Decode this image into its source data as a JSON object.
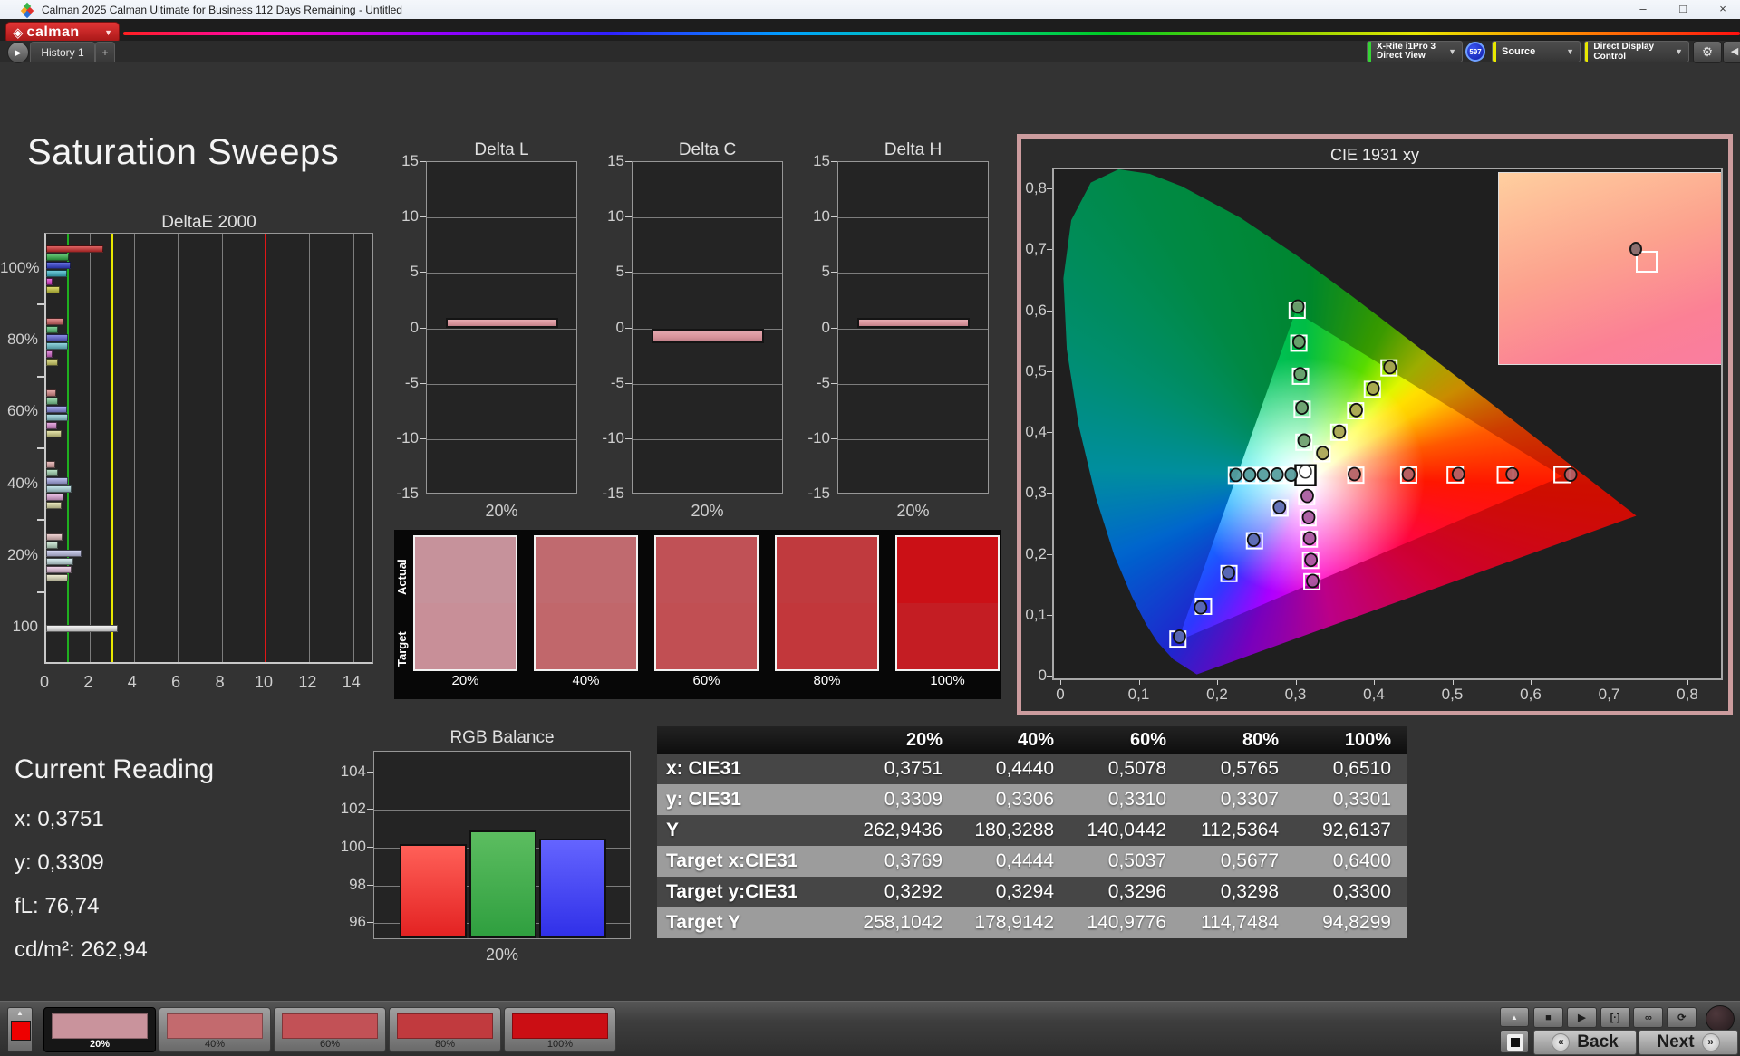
{
  "window": {
    "title": "Calman 2025 Calman Ultimate for Business 112 Days Remaining  - Untitled",
    "minimize_glyph": "–",
    "maximize_glyph": "□",
    "close_glyph": "×"
  },
  "brand": {
    "logo_glyph": "◈",
    "logo_text": "calman",
    "caret_glyph": "▼"
  },
  "toolbar": {
    "history_prev_glyph": "▶",
    "history_tab": "History 1",
    "add_tab": "+",
    "meter_dropdown": {
      "line1": "X-Rite i1Pro 3",
      "line2": "Direct View",
      "stripe": "#35d435"
    },
    "meter_badge": "597",
    "source_dropdown": {
      "label": "Source",
      "stripe": "#e8e800"
    },
    "display_dropdown": {
      "label": "Direct Display Control",
      "stripe": "#e8e800"
    },
    "gear_glyph": "⚙",
    "collapse_glyph": "◀",
    "caret_glyph": "▼"
  },
  "page": {
    "heading": "Saturation Sweeps"
  },
  "swatch_panel": {
    "row_labels": [
      "Actual",
      "Target"
    ],
    "swatches": [
      {
        "label": "20%",
        "actual": "#c6929b",
        "target": "#c88f98"
      },
      {
        "label": "40%",
        "actual": "#c06a6f",
        "target": "#c1676b"
      },
      {
        "label": "60%",
        "actual": "#c05156",
        "target": "#c14f53"
      },
      {
        "label": "80%",
        "actual": "#c03a3e",
        "target": "#c2373b"
      },
      {
        "label": "100%",
        "actual": "#cb1016",
        "target": "#c41d23"
      }
    ]
  },
  "current_reading": {
    "heading": "Current Reading",
    "lines": [
      "x: 0,3751",
      "y: 0,3309",
      "fL: 76,74",
      "cd/m²: 262,94"
    ]
  },
  "bottom_bar": {
    "patch_button": {
      "up_glyph": "▲",
      "patch_color": "#ee0000"
    },
    "swatches": [
      {
        "label": "20%",
        "color": "#c9939c",
        "selected": true
      },
      {
        "label": "40%",
        "color": "#c36a6e",
        "selected": false
      },
      {
        "label": "60%",
        "color": "#c25156",
        "selected": false
      },
      {
        "label": "80%",
        "color": "#c13a3e",
        "selected": false
      },
      {
        "label": "100%",
        "color": "#cb0e14",
        "selected": false
      }
    ],
    "up_glyph": "▲",
    "transport": [
      {
        "name": "stop",
        "glyph": "■"
      },
      {
        "name": "play",
        "glyph": "▶"
      },
      {
        "name": "single",
        "glyph": "[·]"
      },
      {
        "name": "loop",
        "glyph": "∞"
      },
      {
        "name": "refresh",
        "glyph": "⟳"
      }
    ],
    "back_label": "Back",
    "next_label": "Next",
    "prev_glyph": "«",
    "next_glyph": "»"
  },
  "chart_data": {
    "deltae2000": {
      "type": "bar",
      "orientation": "horizontal",
      "title": "DeltaE 2000",
      "xticks": [
        0,
        2,
        4,
        6,
        8,
        10,
        12,
        14
      ],
      "xlim": [
        0,
        15
      ],
      "ref_lines": [
        {
          "value": 1,
          "color": "#1faf1f"
        },
        {
          "value": 3,
          "color": "#e8e800"
        },
        {
          "value": 10,
          "color": "#e01616"
        }
      ],
      "groups": [
        {
          "label": "100%",
          "values": [
            2.6,
            1.05,
            1.1,
            0.95,
            0.3,
            0.6
          ],
          "colors": [
            "#d32f2f",
            "#33b54a",
            "#3340d6",
            "#3fb9cc",
            "#e040d0",
            "#cfcf3f"
          ]
        },
        {
          "label": "80%",
          "values": [
            0.8,
            0.55,
            1.0,
            1.0,
            0.3,
            0.55
          ],
          "colors": [
            "#d96a6a",
            "#57c177",
            "#6468de",
            "#6cc5d2",
            "#d668cd",
            "#d6d468"
          ]
        },
        {
          "label": "60%",
          "values": [
            0.45,
            0.55,
            0.95,
            1.0,
            0.5,
            0.7
          ],
          "colors": [
            "#de8c8c",
            "#7fcc96",
            "#8b8fe5",
            "#93d0da",
            "#de8fd6",
            "#dcda8f"
          ]
        },
        {
          "label": "40%",
          "values": [
            0.4,
            0.55,
            1.0,
            1.15,
            0.8,
            0.7
          ],
          "colors": [
            "#e3a9a9",
            "#a3d6b2",
            "#a9ace9",
            "#b1dce2",
            "#e3aadb",
            "#e2e0a9"
          ]
        },
        {
          "label": "20%",
          "values": [
            0.75,
            0.55,
            1.6,
            1.25,
            1.15,
            1.0
          ],
          "colors": [
            "#e9c3c3",
            "#c2e2cb",
            "#c6c8ef",
            "#cbe6ea",
            "#e9c6e2",
            "#e8e6c4"
          ]
        },
        {
          "label": "100",
          "values": [
            3.25
          ],
          "colors": [
            "#f2f2f2"
          ]
        }
      ]
    },
    "delta_small": {
      "type": "bar",
      "yticks": [
        15,
        10,
        5,
        0,
        -5,
        -10,
        -15
      ],
      "ylim": [
        -15,
        15
      ],
      "bar_color": "#d8939b",
      "xlabel": "20%",
      "charts": [
        {
          "title": "Delta L",
          "value": 0.5
        },
        {
          "title": "Delta C",
          "value": -0.9
        },
        {
          "title": "Delta H",
          "value": 0.5
        }
      ]
    },
    "rgb_balance": {
      "type": "bar",
      "title": "RGB Balance",
      "categories": [
        "Red",
        "Green",
        "Blue"
      ],
      "values": [
        100.1,
        100.8,
        100.4
      ],
      "colors_top": [
        "#ff6058",
        "#5cbd60",
        "#6464ff"
      ],
      "colors_bottom": [
        "#e32222",
        "#2f9f3f",
        "#3030e8"
      ],
      "yticks": [
        104,
        102,
        100,
        98,
        96
      ],
      "ylim": [
        95.1,
        105.1
      ],
      "xlabel": "20%"
    },
    "cie": {
      "type": "scatter",
      "title": "CIE 1931 xy",
      "xlim": [
        0,
        0.85
      ],
      "ylim": [
        0,
        0.84
      ],
      "xtick_labels": [
        "0",
        "0,1",
        "0,2",
        "0,3",
        "0,4",
        "0,5",
        "0,6",
        "0,7",
        "0,8"
      ],
      "ytick_labels": [
        "0",
        "0,1",
        "0,2",
        "0,3",
        "0,4",
        "0,5",
        "0,6",
        "0,7",
        "0,8"
      ],
      "tick_step": 0.1,
      "white_point": [
        0.3127,
        0.329
      ],
      "sweeps": [
        {
          "name": "red",
          "tint": "#b26267",
          "targets": [
            [
              0.3769,
              0.3292
            ],
            [
              0.4444,
              0.3294
            ],
            [
              0.5037,
              0.3296
            ],
            [
              0.5677,
              0.3298
            ],
            [
              0.64,
              0.33
            ]
          ],
          "measured": [
            [
              0.3751,
              0.3309
            ],
            [
              0.444,
              0.3306
            ],
            [
              0.5078,
              0.331
            ],
            [
              0.5765,
              0.3307
            ],
            [
              0.651,
              0.3301
            ]
          ]
        },
        {
          "name": "green",
          "tint": "#6f9e6f",
          "targets": [
            [
              0.3106,
              0.3832
            ],
            [
              0.3085,
              0.4374
            ],
            [
              0.3064,
              0.4916
            ],
            [
              0.3042,
              0.5458
            ],
            [
              0.3021,
              0.6
            ]
          ],
          "measured": [
            [
              0.311,
              0.386
            ],
            [
              0.3082,
              0.44
            ],
            [
              0.306,
              0.495
            ],
            [
              0.3045,
              0.548
            ],
            [
              0.303,
              0.606
            ]
          ]
        },
        {
          "name": "blue",
          "tint": "#5c6bb0",
          "targets": [
            [
              0.2802,
              0.2752
            ],
            [
              0.2477,
              0.2214
            ],
            [
              0.2151,
              0.1676
            ],
            [
              0.1826,
              0.1138
            ],
            [
              0.15,
              0.06
            ]
          ],
          "measured": [
            [
              0.2795,
              0.2765
            ],
            [
              0.2465,
              0.223
            ],
            [
              0.2145,
              0.169
            ],
            [
              0.179,
              0.112
            ],
            [
              0.152,
              0.064
            ]
          ]
        },
        {
          "name": "cyan",
          "tint": "#569b9b",
          "targets": [
            [
              0.2951,
              0.329
            ],
            [
              0.2775,
              0.3289
            ],
            [
              0.2598,
              0.3288
            ],
            [
              0.2422,
              0.3288
            ],
            [
              0.2246,
              0.3287
            ]
          ],
          "measured": [
            [
              0.2945,
              0.33
            ],
            [
              0.2765,
              0.3302
            ],
            [
              0.259,
              0.33
            ],
            [
              0.2415,
              0.3298
            ],
            [
              0.224,
              0.3295
            ]
          ]
        },
        {
          "name": "magenta",
          "tint": "#a75a9d",
          "targets": [
            [
              0.3143,
              0.294
            ],
            [
              0.316,
              0.2591
            ],
            [
              0.3176,
              0.2241
            ],
            [
              0.3193,
              0.1892
            ],
            [
              0.3209,
              0.1542
            ]
          ],
          "measured": [
            [
              0.315,
              0.295
            ],
            [
              0.3168,
              0.26
            ],
            [
              0.318,
              0.2255
            ],
            [
              0.3198,
              0.19
            ],
            [
              0.322,
              0.1555
            ]
          ]
        },
        {
          "name": "yellow",
          "tint": "#a8a455",
          "targets": [
            [
              0.334,
              0.3643
            ],
            [
              0.3553,
              0.3996
            ],
            [
              0.3767,
              0.4348
            ],
            [
              0.398,
              0.4701
            ],
            [
              0.4193,
              0.5053
            ]
          ],
          "measured": [
            [
              0.3348,
              0.3655
            ],
            [
              0.356,
              0.4005
            ],
            [
              0.3775,
              0.436
            ],
            [
              0.399,
              0.4715
            ],
            [
              0.4205,
              0.5065
            ]
          ]
        }
      ],
      "inset": {
        "point_frac": [
          0.615,
          0.4
        ],
        "target_frac": [
          0.655,
          0.455
        ]
      }
    },
    "table": {
      "headers": [
        "",
        "20%",
        "40%",
        "60%",
        "80%",
        "100%"
      ],
      "rows": [
        {
          "label": "x: CIE31",
          "values": [
            "0,3751",
            "0,4440",
            "0,5078",
            "0,5765",
            "0,6510"
          ]
        },
        {
          "label": "y: CIE31",
          "values": [
            "0,3309",
            "0,3306",
            "0,3310",
            "0,3307",
            "0,3301"
          ]
        },
        {
          "label": "Y",
          "values": [
            "262,9436",
            "180,3288",
            "140,0442",
            "112,5364",
            "92,6137"
          ]
        },
        {
          "label": "Target x:CIE31",
          "values": [
            "0,3769",
            "0,4444",
            "0,5037",
            "0,5677",
            "0,6400"
          ]
        },
        {
          "label": "Target y:CIE31",
          "values": [
            "0,3292",
            "0,3294",
            "0,3296",
            "0,3298",
            "0,3300"
          ]
        },
        {
          "label": "Target Y",
          "values": [
            "258,1042",
            "178,9142",
            "140,9776",
            "114,7484",
            "94,8299"
          ]
        }
      ]
    }
  }
}
